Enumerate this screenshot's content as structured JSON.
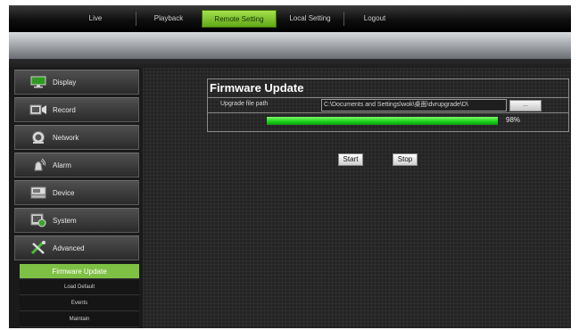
{
  "nav": {
    "tabs": [
      {
        "label": "Live"
      },
      {
        "label": "Playback"
      },
      {
        "label": "Remote Setting",
        "active": true
      },
      {
        "label": "Local Setting"
      },
      {
        "label": "Logout"
      }
    ]
  },
  "sidebar": {
    "items": [
      {
        "label": "Display",
        "icon": "monitor-icon"
      },
      {
        "label": "Record",
        "icon": "record-icon"
      },
      {
        "label": "Network",
        "icon": "network-icon"
      },
      {
        "label": "Alarm",
        "icon": "alarm-icon"
      },
      {
        "label": "Device",
        "icon": "device-icon"
      },
      {
        "label": "System",
        "icon": "system-icon"
      },
      {
        "label": "Advanced",
        "icon": "tools-icon"
      }
    ],
    "subitems": [
      {
        "label": "Firmware Update",
        "active": true
      },
      {
        "label": "Load Default"
      },
      {
        "label": "Events"
      },
      {
        "label": "Maintain"
      }
    ]
  },
  "firmware": {
    "title": "Firmware Update",
    "path_label": "Upgrade file path",
    "path_value": "C:\\Documents and Settings\\wok\\桌面\\dvrupgrade\\D\\",
    "browse_label": "...",
    "progress_percent": 98,
    "progress_text": "98%",
    "start_label": "Start",
    "stop_label": "Stop"
  },
  "colors": {
    "accent": "#7ec043",
    "progress": "#1ed51c",
    "background": "#242424"
  }
}
